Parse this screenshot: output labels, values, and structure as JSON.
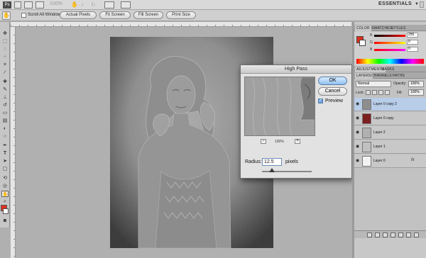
{
  "menubar": {
    "zoom": "100%",
    "workspace": "ESSENTIALS"
  },
  "options": {
    "scroll_all_windows": "Scroll All Windows",
    "buttons": [
      "Actual Pixels",
      "Fit Screen",
      "Fill Screen",
      "Print Size"
    ]
  },
  "dialog": {
    "title": "High Pass",
    "ok": "OK",
    "cancel": "Cancel",
    "preview": "Preview",
    "zoom_level": "100%",
    "radius_label": "Radius:",
    "radius_value": "12.5",
    "radius_unit": "pixels"
  },
  "color_panel": {
    "tabs": [
      "COLOR",
      "SWATCHES",
      "STYLES"
    ],
    "channels": [
      {
        "label": "R",
        "value": "255"
      },
      {
        "label": "G",
        "value": "0"
      },
      {
        "label": "B",
        "value": "0"
      }
    ],
    "foreground": "#e0301e",
    "background": "#ffffff"
  },
  "adjust_panel": {
    "tabs": [
      "ADJUSTMENTS",
      "MASKS"
    ]
  },
  "layers_panel": {
    "tabs": [
      "LAYERS",
      "CHANNELS",
      "PATHS"
    ],
    "blend_mode": "Normal",
    "opacity_label": "Opacity:",
    "opacity_value": "100%",
    "lock_label": "Lock:",
    "fill_label": "Fill:",
    "fill_value": "100%",
    "layers": [
      {
        "name": "Layer 0 copy 2",
        "selected": true,
        "fx": false,
        "thumb": "#8e8e8e"
      },
      {
        "name": "Layer 0 copy",
        "selected": false,
        "fx": false,
        "thumb": "#7b1f1f"
      },
      {
        "name": "Layer 2",
        "selected": false,
        "fx": false,
        "thumb": "#b0b0b0"
      },
      {
        "name": "Layer 1",
        "selected": false,
        "fx": false,
        "thumb": "#c0c0c0"
      },
      {
        "name": "Layer 0",
        "selected": false,
        "fx": true,
        "fx_label": "fx",
        "thumb": "#f2f2f2"
      }
    ]
  }
}
